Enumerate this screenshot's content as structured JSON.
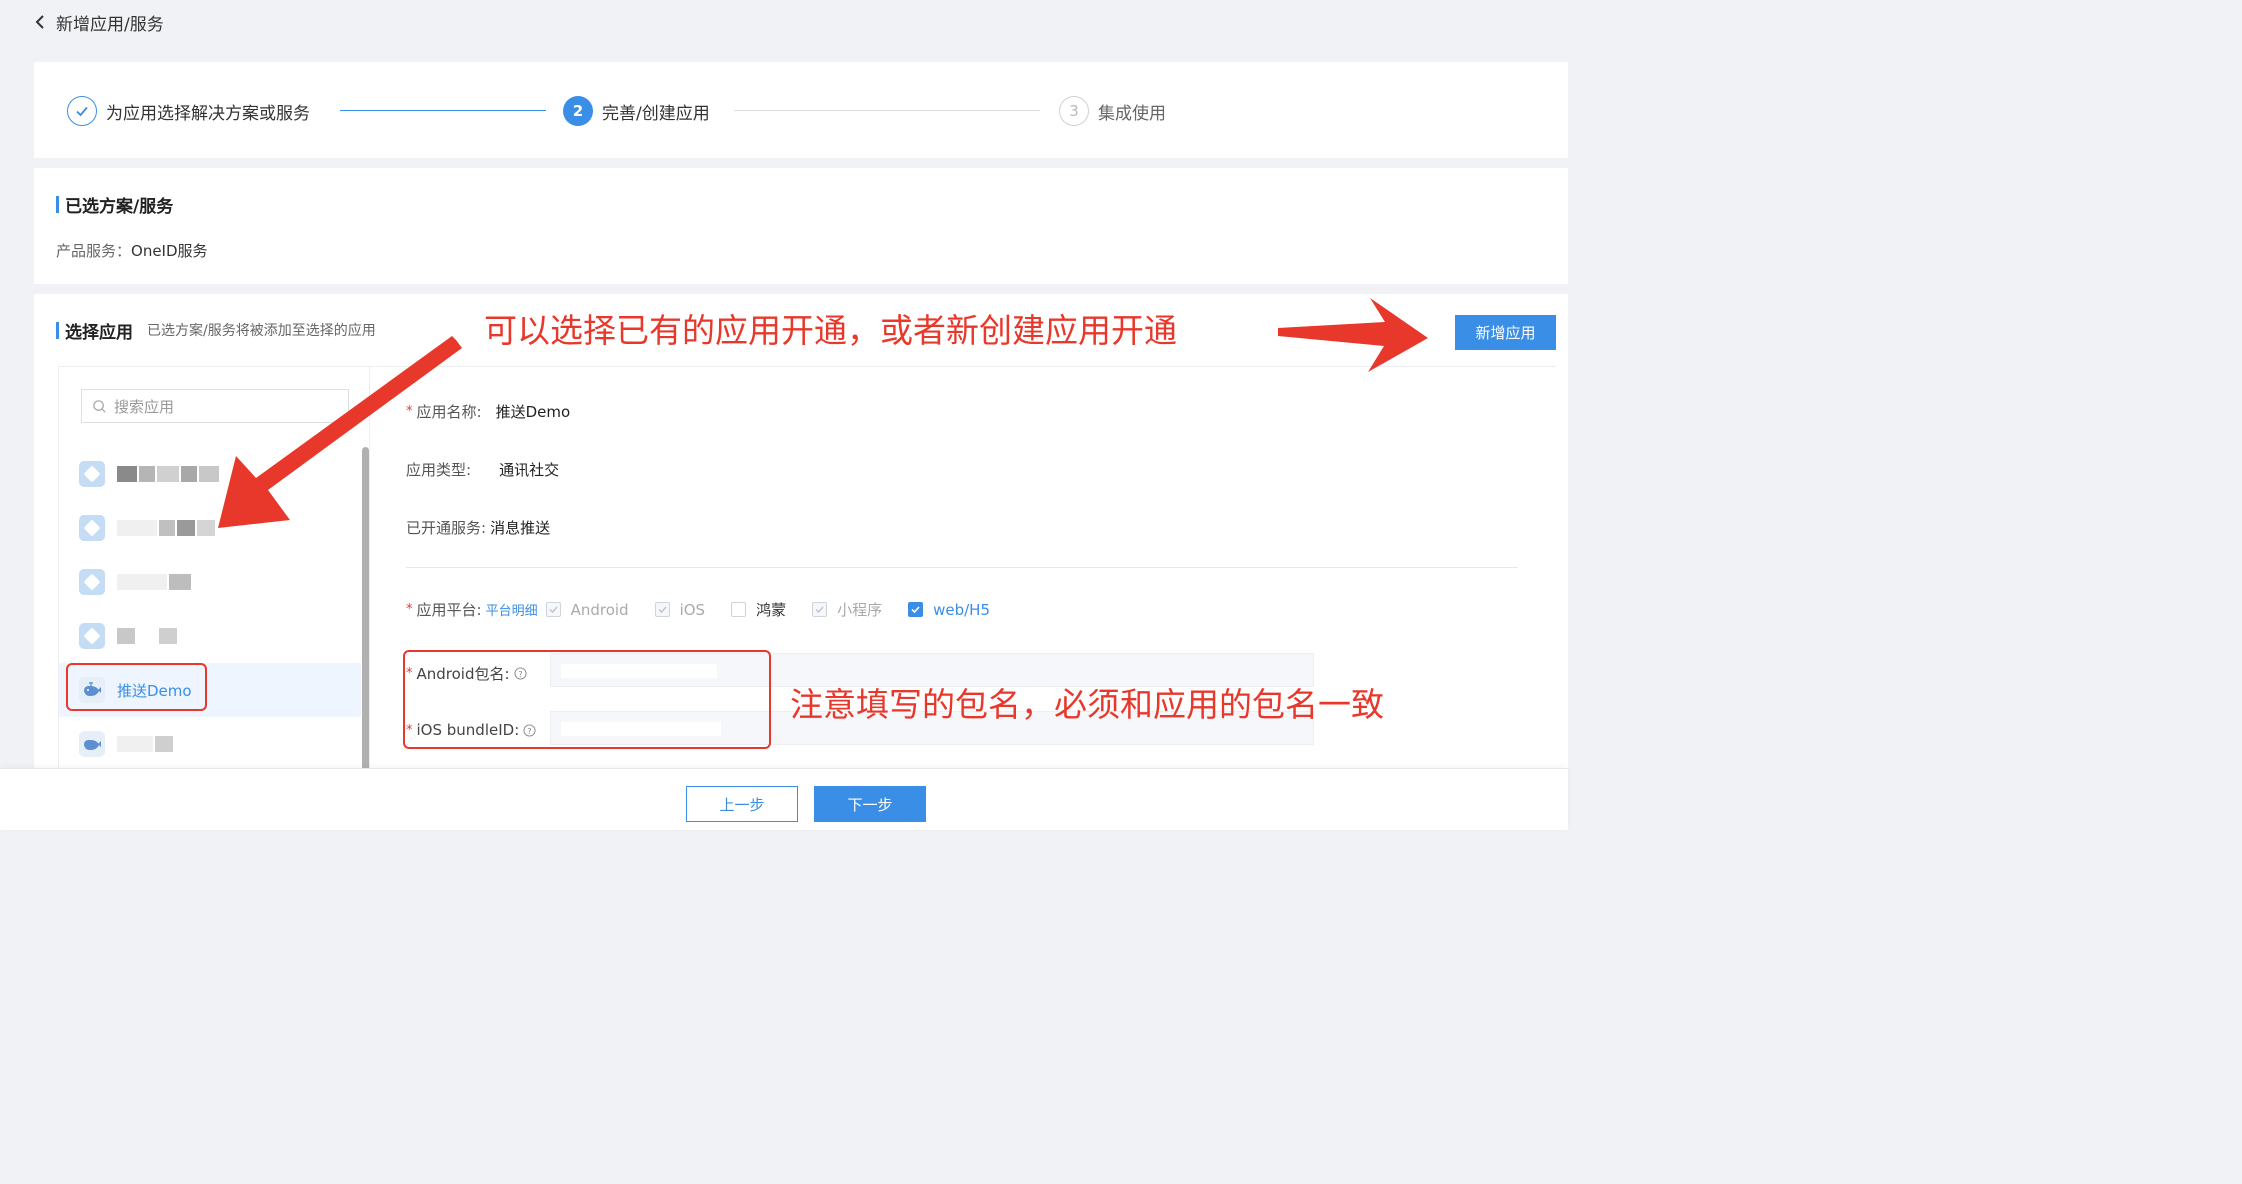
{
  "header": {
    "title": "新增应用/服务"
  },
  "steps": [
    {
      "number": "",
      "label": "为应用选择解决方案或服务"
    },
    {
      "number": "2",
      "label": "完善/创建应用"
    },
    {
      "number": "3",
      "label": "集成使用"
    }
  ],
  "selected": {
    "title": "已选方案/服务",
    "product_label": "产品服务：",
    "product_value": "OneID服务"
  },
  "apps": {
    "title": "选择应用",
    "subtitle": "已选方案/服务将被添加至选择的应用",
    "new_app_label": "新增应用",
    "search_placeholder": "搜索应用",
    "active_app": "推送Demo"
  },
  "form": {
    "app_name_label": "应用名称:",
    "app_name_value": "推送Demo",
    "app_type_label": "应用类型:",
    "app_type_value": "通讯社交",
    "services_label": "已开通服务:",
    "services_value": "消息推送",
    "platform_label": "应用平台:",
    "platform_link": "平台明细",
    "platforms": [
      "Android",
      "iOS",
      "鸿蒙",
      "小程序",
      "web/H5"
    ],
    "android_pkg_label": "Android包名:",
    "ios_bundle_label": "iOS bundleID:"
  },
  "annotations": {
    "top": "可以选择已有的应用开通，或者新创建应用开通",
    "bottom": "注意填写的包名，必须和应用的包名一致"
  },
  "footer": {
    "prev_label": "上一步",
    "next_label": "下一步"
  },
  "colors": {
    "accent": "#3a8ee6",
    "annotation": "#e8382b"
  }
}
